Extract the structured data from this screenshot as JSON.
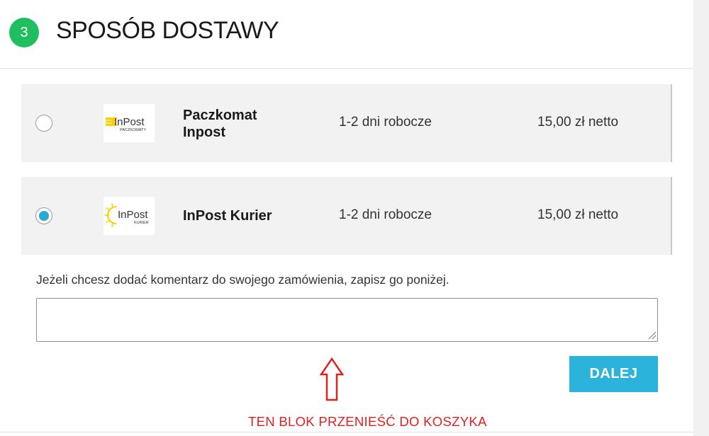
{
  "step": {
    "number": "3",
    "title": "SPOSÓB DOSTAWY"
  },
  "shipping_options": [
    {
      "logo_text": "InPost",
      "logo_subtext": "PACZKOMATY",
      "name": "Paczkomat Inpost",
      "delivery_time": "1-2 dni robocze",
      "price": "15,00 zł netto",
      "selected": false
    },
    {
      "logo_text": "InPost",
      "logo_subtext": "KURIER",
      "name": "InPost Kurier",
      "delivery_time": "1-2 dni robocze",
      "price": "15,00 zł netto",
      "selected": true
    }
  ],
  "comment": {
    "label": "Jeżeli chcesz dodać komentarz do swojego zamówienia, zapisz go poniżej.",
    "value": ""
  },
  "next_button": {
    "label": "DALEJ"
  },
  "annotation": {
    "text": "TEN BLOK PRZENIEŚĆ DO KOSZYKA"
  },
  "colors": {
    "step_circle": "#1fbf5f",
    "button": "#2bb3dc",
    "radio_selected": "#2aa9d6",
    "annotation": "#e02020",
    "option_background": "#f2f2f2",
    "inpost_yellow": "#ffcd00"
  }
}
